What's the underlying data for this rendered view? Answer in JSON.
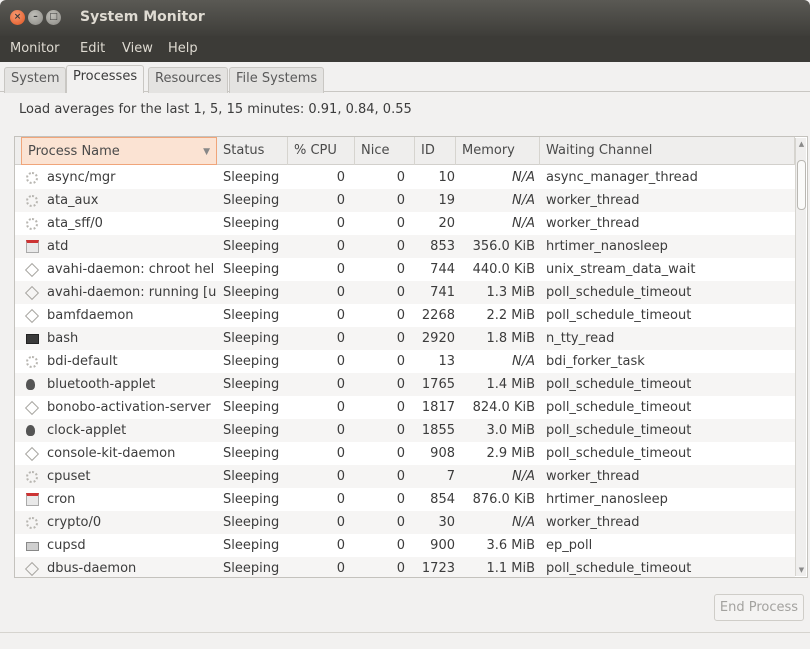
{
  "window": {
    "title": "System Monitor"
  },
  "menu": [
    "Monitor",
    "Edit",
    "View",
    "Help"
  ],
  "tabs": [
    "System",
    "Processes",
    "Resources",
    "File Systems"
  ],
  "active_tab": "Processes",
  "load_averages": "Load averages for the last 1, 5, 15 minutes: 0.91, 0.84, 0.55",
  "columns": [
    "Process Name",
    "Status",
    "% CPU",
    "Nice",
    "ID",
    "Memory",
    "Waiting Channel"
  ],
  "sorted_column": "Process Name",
  "processes": [
    {
      "icon": "gear-icon",
      "name": "async/mgr",
      "status": "Sleeping",
      "cpu": "0",
      "nice": "0",
      "id": "10",
      "memory": "N/A",
      "channel": "async_manager_thread"
    },
    {
      "icon": "gear-icon",
      "name": "ata_aux",
      "status": "Sleeping",
      "cpu": "0",
      "nice": "0",
      "id": "19",
      "memory": "N/A",
      "channel": "worker_thread"
    },
    {
      "icon": "gear-icon",
      "name": "ata_sff/0",
      "status": "Sleeping",
      "cpu": "0",
      "nice": "0",
      "id": "20",
      "memory": "N/A",
      "channel": "worker_thread"
    },
    {
      "icon": "calendar-icon",
      "name": "atd",
      "status": "Sleeping",
      "cpu": "0",
      "nice": "0",
      "id": "853",
      "memory": "356.0 KiB",
      "channel": "hrtimer_nanosleep"
    },
    {
      "icon": "diamond-icon",
      "name": "avahi-daemon: chroot hel",
      "status": "Sleeping",
      "cpu": "0",
      "nice": "0",
      "id": "744",
      "memory": "440.0 KiB",
      "channel": "unix_stream_data_wait"
    },
    {
      "icon": "diamond-icon",
      "name": "avahi-daemon: running [u",
      "status": "Sleeping",
      "cpu": "0",
      "nice": "0",
      "id": "741",
      "memory": "1.3 MiB",
      "channel": "poll_schedule_timeout"
    },
    {
      "icon": "diamond-icon",
      "name": "bamfdaemon",
      "status": "Sleeping",
      "cpu": "0",
      "nice": "0",
      "id": "2268",
      "memory": "2.2 MiB",
      "channel": "poll_schedule_timeout"
    },
    {
      "icon": "terminal-icon",
      "name": "bash",
      "status": "Sleeping",
      "cpu": "0",
      "nice": "0",
      "id": "2920",
      "memory": "1.8 MiB",
      "channel": "n_tty_read"
    },
    {
      "icon": "gear-icon",
      "name": "bdi-default",
      "status": "Sleeping",
      "cpu": "0",
      "nice": "0",
      "id": "13",
      "memory": "N/A",
      "channel": "bdi_forker_task"
    },
    {
      "icon": "bluetooth-icon",
      "name": "bluetooth-applet",
      "status": "Sleeping",
      "cpu": "0",
      "nice": "0",
      "id": "1765",
      "memory": "1.4 MiB",
      "channel": "poll_schedule_timeout"
    },
    {
      "icon": "diamond-icon",
      "name": "bonobo-activation-server",
      "status": "Sleeping",
      "cpu": "0",
      "nice": "0",
      "id": "1817",
      "memory": "824.0 KiB",
      "channel": "poll_schedule_timeout"
    },
    {
      "icon": "bluetooth-icon",
      "name": "clock-applet",
      "status": "Sleeping",
      "cpu": "0",
      "nice": "0",
      "id": "1855",
      "memory": "3.0 MiB",
      "channel": "poll_schedule_timeout"
    },
    {
      "icon": "diamond-icon",
      "name": "console-kit-daemon",
      "status": "Sleeping",
      "cpu": "0",
      "nice": "0",
      "id": "908",
      "memory": "2.9 MiB",
      "channel": "poll_schedule_timeout"
    },
    {
      "icon": "gear-icon",
      "name": "cpuset",
      "status": "Sleeping",
      "cpu": "0",
      "nice": "0",
      "id": "7",
      "memory": "N/A",
      "channel": "worker_thread"
    },
    {
      "icon": "calendar-icon",
      "name": "cron",
      "status": "Sleeping",
      "cpu": "0",
      "nice": "0",
      "id": "854",
      "memory": "876.0 KiB",
      "channel": "hrtimer_nanosleep"
    },
    {
      "icon": "gear-icon",
      "name": "crypto/0",
      "status": "Sleeping",
      "cpu": "0",
      "nice": "0",
      "id": "30",
      "memory": "N/A",
      "channel": "worker_thread"
    },
    {
      "icon": "printer-icon",
      "name": "cupsd",
      "status": "Sleeping",
      "cpu": "0",
      "nice": "0",
      "id": "900",
      "memory": "3.6 MiB",
      "channel": "ep_poll"
    },
    {
      "icon": "diamond-icon",
      "name": "dbus-daemon",
      "status": "Sleeping",
      "cpu": "0",
      "nice": "0",
      "id": "1723",
      "memory": "1.1 MiB",
      "channel": "poll_schedule_timeout"
    }
  ],
  "buttons": {
    "end_process": "End Process"
  }
}
